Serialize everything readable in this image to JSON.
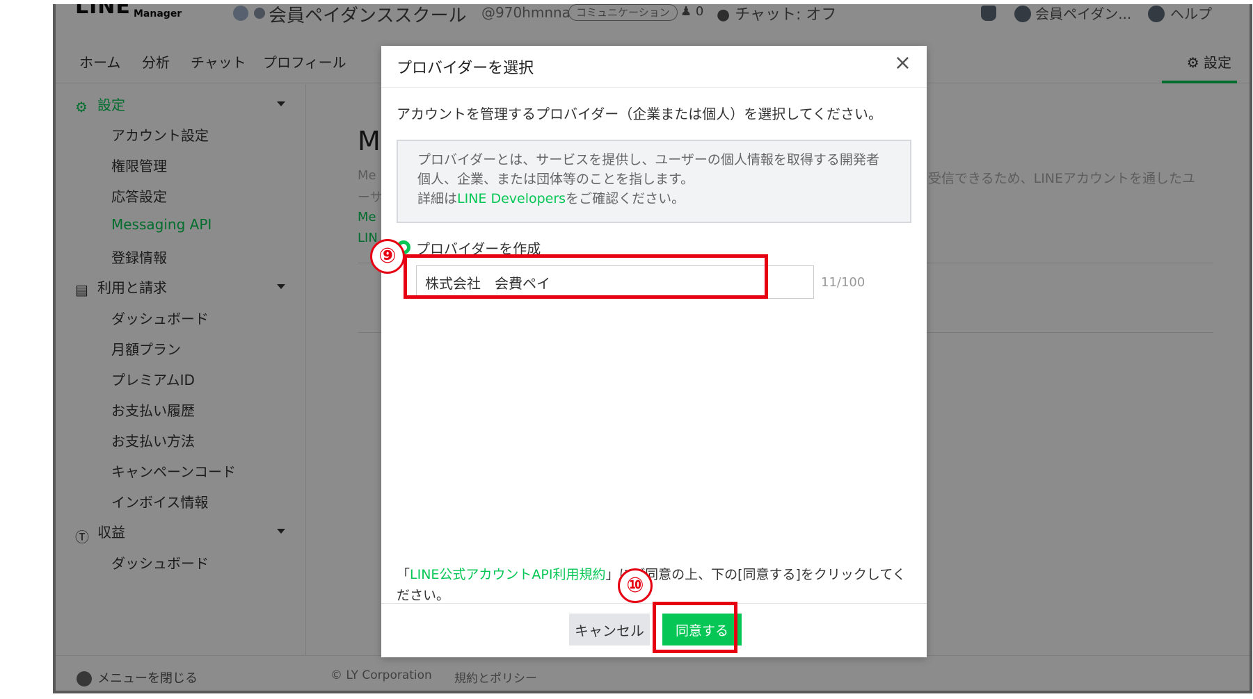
{
  "header": {
    "logo": "LINE",
    "logo_sub": "Manager",
    "account_name": "会員ペイダンススクール",
    "account_id": "@970hmnna",
    "account_badge": "コミュニケーション",
    "friends_count": "0",
    "chat_status": "チャット: オフ",
    "user_name": "会員ペイダン...",
    "help_label": "ヘルプ"
  },
  "nav": {
    "tabs": [
      "ホーム",
      "分析",
      "チャット",
      "プロフィール"
    ],
    "settings_label": "設定"
  },
  "sidebar": {
    "settings_group": "設定",
    "settings_items": [
      "アカウント設定",
      "権限管理",
      "応答設定",
      "Messaging API",
      "登録情報"
    ],
    "billing_group": "利用と請求",
    "billing_items": [
      "ダッシュボード",
      "月額プラン",
      "プレミアムID",
      "お支払い履歴",
      "お支払い方法",
      "キャンペーンコード",
      "インボイス情報"
    ],
    "revenue_group": "収益",
    "revenue_items": [
      "ダッシュボード"
    ]
  },
  "main": {
    "title_partial": "M",
    "text1_partial": "Me",
    "text2_partial": "ーサ",
    "link1_partial": "Me",
    "link2_partial": "LIN",
    "right_text": "受信できるため、LINEアカウントを通したユ"
  },
  "footer": {
    "collapse_label": "メニューを閉じる",
    "copyright": "© LY Corporation",
    "policy": "規約とポリシー"
  },
  "modal": {
    "title": "プロバイダーを選択",
    "close_icon": "×",
    "description": "アカウントを管理するプロバイダー（企業または個人）を選択してください。",
    "info_line1": "プロバイダーとは、サービスを提供し、ユーザーの個人情報を取得する開発者",
    "info_line2": "個人、企業、または団体等のことを指します。",
    "info_line3_prefix": "詳細は",
    "info_link": "LINE Developers",
    "info_line3_suffix": "をご確認ください。",
    "radio_label": "プロバイダーを作成",
    "provider_name_value": "株式会社　会費ペイ",
    "char_count": "11/100",
    "terms_prefix": "「",
    "terms_link": "LINE公式アカウントAPI利用規約",
    "terms_suffix": "」にご同意の上、下の[同意する]をクリックしてください。",
    "cancel_label": "キャンセル",
    "agree_label": "同意する"
  },
  "annotations": {
    "step9": "⑨",
    "step10": "⑩"
  },
  "colors": {
    "accent": "#06c755",
    "annotation": "#e60012",
    "overlay": "rgba(0,0,0,0.45)"
  }
}
